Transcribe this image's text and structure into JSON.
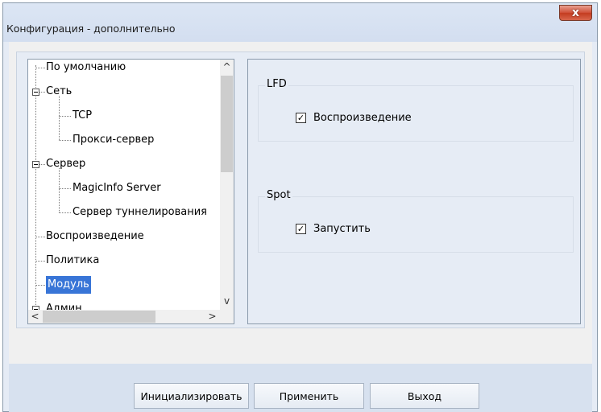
{
  "window": {
    "title": "Конфигурация - дополнительно",
    "close_label": "x"
  },
  "tree": {
    "items": [
      {
        "label": "По умолчанию",
        "level": 1
      },
      {
        "label": "Сеть",
        "level": 0,
        "expanded": true
      },
      {
        "label": "TCP",
        "level": 2
      },
      {
        "label": "Прокси-сервер",
        "level": 2
      },
      {
        "label": "Сервер",
        "level": 0,
        "expanded": true
      },
      {
        "label": "MagicInfo Server",
        "level": 2
      },
      {
        "label": "Сервер туннелирования",
        "level": 2
      },
      {
        "label": "Воспроизведение",
        "level": 1
      },
      {
        "label": "Политика",
        "level": 1
      },
      {
        "label": "Модуль",
        "level": 1,
        "selected": true
      },
      {
        "label": "Админ",
        "level": 0,
        "partially_visible": true
      }
    ],
    "scroll_up": "^",
    "scroll_down": "v",
    "scroll_left": "<",
    "scroll_right": ">"
  },
  "settings": {
    "lfd": {
      "legend": "LFD",
      "checkbox_label": "Воспроизведение",
      "checked": true
    },
    "spot": {
      "legend": "Spot",
      "checkbox_label": "Запустить",
      "checked": true
    }
  },
  "buttons": {
    "initialize": "Инициализировать",
    "apply": "Применить",
    "exit": "Выход"
  },
  "colors": {
    "selection": "#3875d7",
    "close_button": "#c8472c"
  }
}
